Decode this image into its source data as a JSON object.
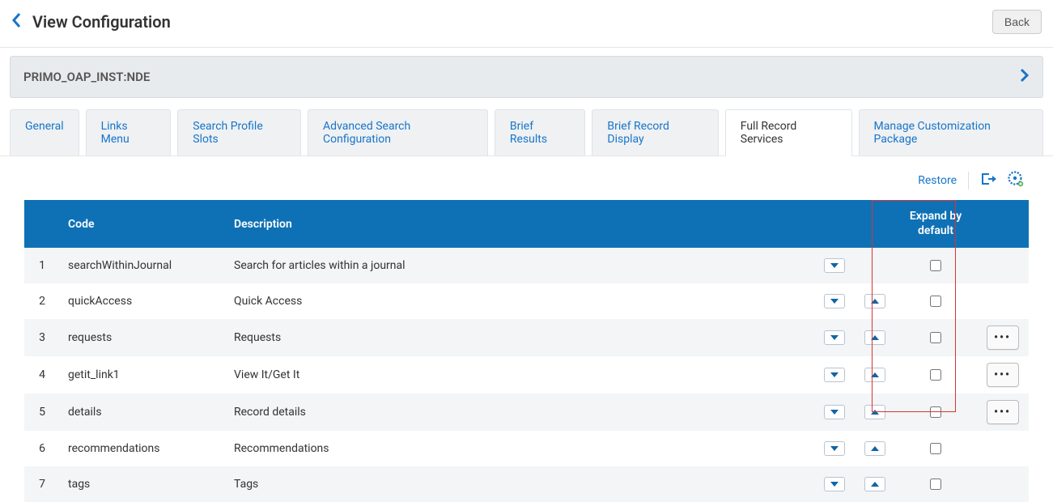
{
  "header": {
    "title": "View Configuration",
    "back_label": "Back"
  },
  "banner": {
    "text": "PRIMO_OAP_INST:NDE"
  },
  "tabs": [
    {
      "label": "General",
      "active": false
    },
    {
      "label": "Links Menu",
      "active": false
    },
    {
      "label": "Search Profile Slots",
      "active": false
    },
    {
      "label": "Advanced Search Configuration",
      "active": false
    },
    {
      "label": "Brief Results",
      "active": false
    },
    {
      "label": "Brief Record Display",
      "active": false
    },
    {
      "label": "Full Record Services",
      "active": true
    },
    {
      "label": "Manage Customization Package",
      "active": false
    }
  ],
  "toolbar": {
    "restore_label": "Restore"
  },
  "table": {
    "headers": {
      "code": "Code",
      "description": "Description",
      "expand": "Expand by default"
    },
    "rows": [
      {
        "n": "1",
        "code": "searchWithinJournal",
        "desc": "Search for articles within a journal",
        "down": true,
        "up": false,
        "checked": false,
        "more": false
      },
      {
        "n": "2",
        "code": "quickAccess",
        "desc": "Quick Access",
        "down": true,
        "up": true,
        "checked": false,
        "more": false
      },
      {
        "n": "3",
        "code": "requests",
        "desc": "Requests",
        "down": true,
        "up": true,
        "checked": false,
        "more": true
      },
      {
        "n": "4",
        "code": "getit_link1",
        "desc": "View It/Get It",
        "down": true,
        "up": true,
        "checked": false,
        "more": true
      },
      {
        "n": "5",
        "code": "details",
        "desc": "Record details",
        "down": true,
        "up": true,
        "checked": false,
        "more": true
      },
      {
        "n": "6",
        "code": "recommendations",
        "desc": "Recommendations",
        "down": true,
        "up": true,
        "checked": false,
        "more": false
      },
      {
        "n": "7",
        "code": "tags",
        "desc": "Tags",
        "down": true,
        "up": true,
        "checked": false,
        "more": false
      }
    ]
  }
}
